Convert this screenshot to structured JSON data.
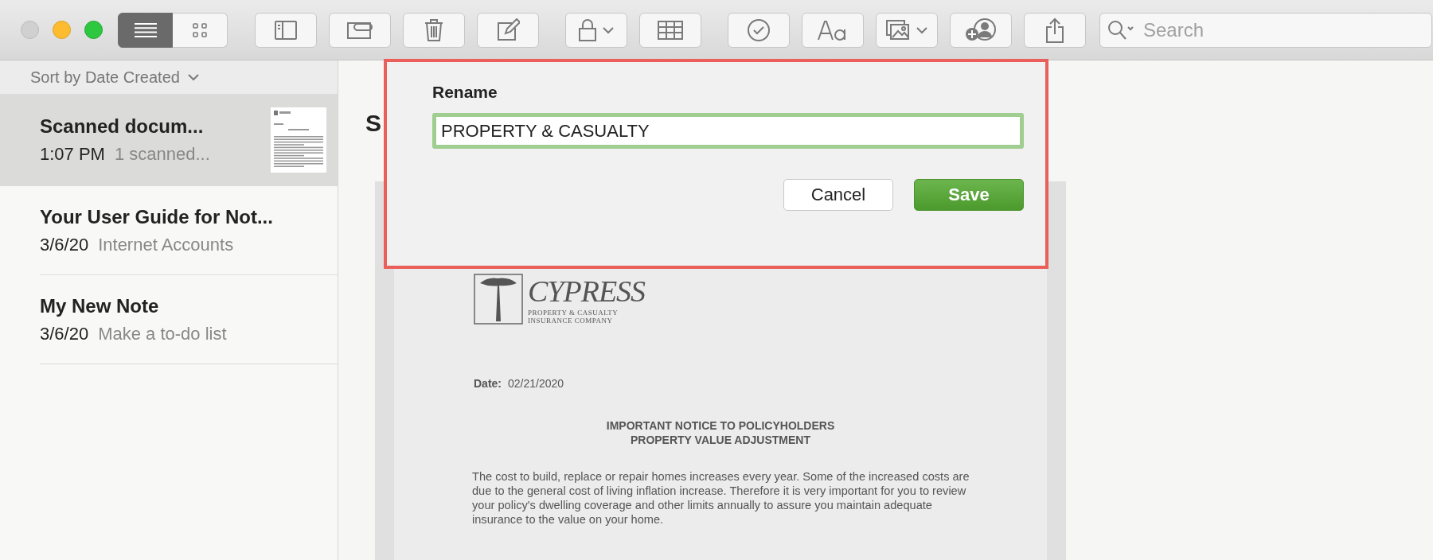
{
  "toolbar": {
    "view_toggle": [
      {
        "selected": true
      },
      {
        "selected": false
      }
    ],
    "search": {
      "placeholder": "Search"
    }
  },
  "sidebar": {
    "sort_label": "Sort by Date Created",
    "notes": [
      {
        "title": "Scanned docum...",
        "date": "1:07 PM",
        "preview": "1 scanned...",
        "selected": true,
        "thumbnail": true
      },
      {
        "title": "Your User Guide for Not...",
        "date": "3/6/20",
        "preview": "Internet Accounts",
        "selected": false,
        "thumbnail": false
      },
      {
        "title": "My New Note",
        "date": "3/6/20",
        "preview": "Make a to-do list",
        "selected": false,
        "thumbnail": false
      }
    ]
  },
  "note": {
    "title": "S",
    "document": {
      "logo_name": "CYPRESS",
      "logo_lines": [
        "PROPERTY & CASUALTY",
        "INSURANCE COMPANY"
      ],
      "date_label": "Date:",
      "date": "02/21/2020",
      "heading": [
        "IMPORTANT NOTICE TO POLICYHOLDERS",
        "PROPERTY VALUE ADJUSTMENT"
      ],
      "paragraph": "The cost to build, replace or repair homes increases every year.  Some of the increased costs are due to the general cost of living inflation increase.  Therefore it is very important for you to review your policy's dwelling coverage and other limits annually to assure you maintain adequate insurance to the value on your home."
    }
  },
  "rename_dialog": {
    "label": "Rename",
    "value": "PROPERTY & CASUALTY",
    "buttons": [
      {
        "label": "Cancel",
        "kind": "secondary"
      },
      {
        "label": "Save",
        "kind": "primary"
      }
    ]
  }
}
